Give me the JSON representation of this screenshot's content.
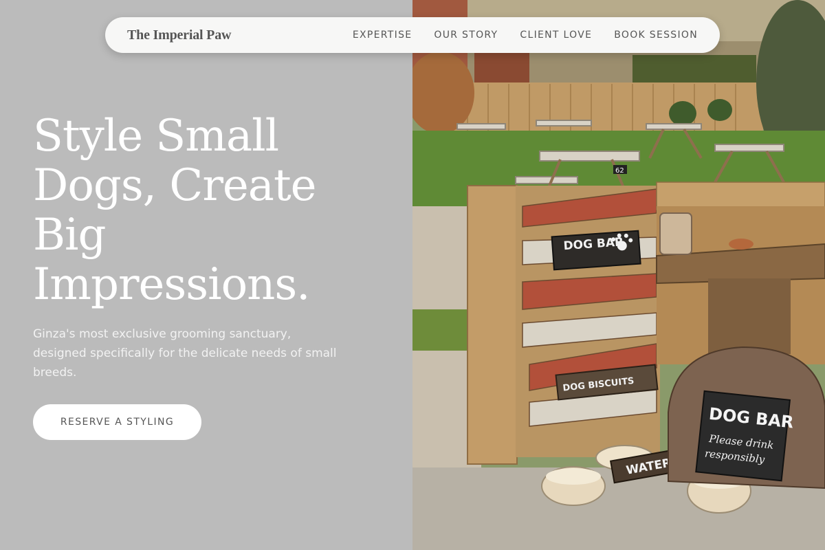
{
  "brand": {
    "name": "The Imperial Paw"
  },
  "nav": {
    "items": [
      {
        "label": "EXPERTISE"
      },
      {
        "label": "OUR STORY"
      },
      {
        "label": "CLIENT LOVE"
      },
      {
        "label": "BOOK SESSION"
      }
    ]
  },
  "hero": {
    "title": "Style Small Dogs, Create Big Impressions.",
    "subtitle": "Ginza's most exclusive grooming sanctuary, designed specifically for the delicate needs of small breeds.",
    "cta_label": "RESERVE A STYLING"
  },
  "photo": {
    "signs": {
      "dog_bar_top": "DOG BAR",
      "dog_biscuits": "DOG BISCUITS",
      "water": "WATER",
      "dog_bar_board": "DOG BAR",
      "board_line1": "Please drink",
      "board_line2": "responsibly",
      "table_number": "62"
    }
  },
  "colors": {
    "left_panel_bg": "#bbbbbb",
    "nav_bg": "#f7f7f6",
    "text_muted": "#555555",
    "title_text": "#ffffff"
  }
}
